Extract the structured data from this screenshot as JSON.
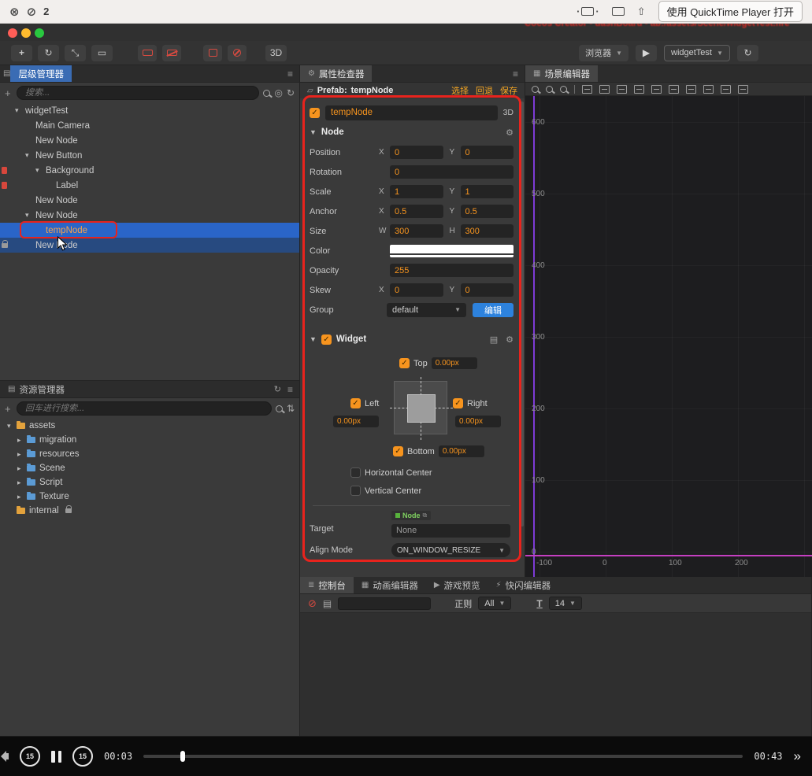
{
  "menubar": {
    "recording_count": "2",
    "open_with": "使用 QuickTime Player 打开"
  },
  "titlebar": {
    "window_title": "Cocos Creator - dashBoard - ab:/assets/Scene/widgetTest.fire"
  },
  "toolbar": {
    "mode_3d": "3D",
    "browser": "浏览器",
    "scene_select": "widgetTest"
  },
  "hierarchy": {
    "tab": "层级管理器",
    "search_placeholder": "搜索...",
    "tree": [
      {
        "label": "widgetTest",
        "depth": 0,
        "expandable": true
      },
      {
        "label": "Main Camera",
        "depth": 1
      },
      {
        "label": "New Node",
        "depth": 1
      },
      {
        "label": "New Button",
        "depth": 1,
        "expandable": true
      },
      {
        "label": "Background",
        "depth": 2,
        "expandable": true,
        "marker": true
      },
      {
        "label": "Label",
        "depth": 3,
        "marker": true
      },
      {
        "label": "New Node",
        "depth": 1
      },
      {
        "label": "New Node",
        "depth": 1,
        "expandable": true
      },
      {
        "label": "tempNode",
        "depth": 2,
        "state": "selected",
        "redbox": true
      },
      {
        "label": "New Node",
        "depth": 1,
        "state": "secondary",
        "lock": true
      }
    ]
  },
  "assets": {
    "tab": "资源管理器",
    "search_placeholder": "回车进行搜索...",
    "tree": [
      {
        "label": "assets",
        "depth": 0,
        "expandable": true,
        "open": true,
        "color": "orange"
      },
      {
        "label": "migration",
        "depth": 1,
        "expandable": true
      },
      {
        "label": "resources",
        "depth": 1,
        "expandable": true
      },
      {
        "label": "Scene",
        "depth": 1,
        "expandable": true
      },
      {
        "label": "Script",
        "depth": 1,
        "expandable": true
      },
      {
        "label": "Texture",
        "depth": 1,
        "expandable": true
      },
      {
        "label": "internal",
        "depth": 0,
        "color": "orange",
        "lock": true
      }
    ]
  },
  "inspector": {
    "tab": "属性检查器",
    "prefab": {
      "label": "Prefab:",
      "name": "tempNode",
      "actions": [
        "选择",
        "回退",
        "保存"
      ]
    },
    "node_name": "tempNode",
    "badge_3d": "3D",
    "sections": {
      "node": "Node",
      "widget": "Widget"
    },
    "props": {
      "position": {
        "label": "Position",
        "ax": "X",
        "ay": "Y",
        "x": "0",
        "y": "0"
      },
      "rotation": {
        "label": "Rotation",
        "value": "0"
      },
      "scale": {
        "label": "Scale",
        "ax": "X",
        "ay": "Y",
        "x": "1",
        "y": "1"
      },
      "anchor": {
        "label": "Anchor",
        "ax": "X",
        "ay": "Y",
        "x": "0.5",
        "y": "0.5"
      },
      "size": {
        "label": "Size",
        "ax": "W",
        "ay": "H",
        "w": "300",
        "h": "300"
      },
      "color": {
        "label": "Color"
      },
      "opacity": {
        "label": "Opacity",
        "value": "255"
      },
      "skew": {
        "label": "Skew",
        "ax": "X",
        "ay": "Y",
        "x": "0",
        "y": "0"
      },
      "group": {
        "label": "Group",
        "value": "default",
        "edit": "编辑"
      }
    },
    "widget": {
      "top_label": "Top",
      "top_value": "0.00px",
      "left_label": "Left",
      "left_value": "0.00px",
      "right_label": "Right",
      "right_value": "0.00px",
      "bottom_label": "Bottom",
      "bottom_value": "0.00px",
      "h_center": "Horizontal Center",
      "v_center": "Vertical Center",
      "target_label": "Target",
      "target_chip": "Node",
      "target_value": "None",
      "align_label": "Align Mode",
      "align_value": "ON_WINDOW_RESIZE"
    }
  },
  "scene": {
    "tab": "场景编辑器",
    "y_axis_labels": [
      "600",
      "500",
      "400",
      "300",
      "200",
      "100",
      "0"
    ],
    "x_axis_labels": [
      "-100",
      "0",
      "100",
      "200"
    ],
    "toolbar_icons": [
      "zoom-in-icon",
      "zoom-out-icon",
      "zoom-reset-icon",
      "separator",
      "align-top-icon",
      "align-middle-icon",
      "align-bottom-icon",
      "align-left-icon",
      "align-center-icon",
      "align-right-icon",
      "distribute-horizontal-icon",
      "distribute-vertical-icon",
      "stretch-horizontal-icon",
      "stretch-vertical-icon"
    ]
  },
  "console": {
    "tabs": [
      "控制台",
      "动画编辑器",
      "游戏预览",
      "快闪编辑器"
    ],
    "regex_label": "正则",
    "filter_value": "All",
    "fontsize_value": "14"
  },
  "player": {
    "current": "00:03",
    "duration": "00:43",
    "skip_back": "15",
    "skip_forward": "15"
  }
}
